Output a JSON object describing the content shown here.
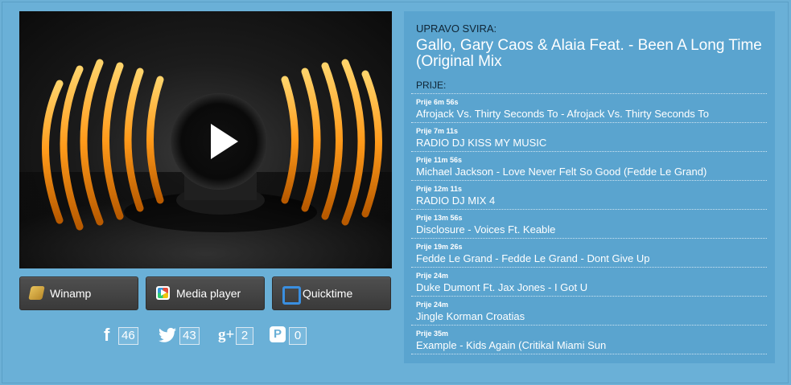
{
  "player": {
    "play_label": "Play"
  },
  "buttons": [
    {
      "label": "Winamp",
      "icon": "winamp-icon"
    },
    {
      "label": "Media player",
      "icon": "media-player-icon"
    },
    {
      "label": "Quicktime",
      "icon": "quicktime-icon"
    }
  ],
  "social": [
    {
      "network": "facebook",
      "glyph": "f",
      "count": "46",
      "icon": "facebook-icon"
    },
    {
      "network": "twitter",
      "glyph": "🐦",
      "count": "43",
      "icon": "twitter-icon"
    },
    {
      "network": "google-plus",
      "glyph": "g+",
      "count": "2",
      "icon": "google-plus-icon"
    },
    {
      "network": "pinterest",
      "glyph": "P",
      "count": "0",
      "icon": "pinterest-icon"
    }
  ],
  "now_playing": {
    "label": "UPRAVO SVIRA:",
    "title": "Gallo, Gary Caos & Alaia Feat. - Been A Long Time (Original Mix"
  },
  "history": {
    "label": "PRIJE:",
    "items": [
      {
        "time": "Prije 6m 56s",
        "title": "Afrojack Vs. Thirty Seconds To - Afrojack Vs. Thirty Seconds To"
      },
      {
        "time": "Prije 7m 11s",
        "title": "RADIO DJ KISS MY MUSIC"
      },
      {
        "time": "Prije 11m 56s",
        "title": "Michael Jackson - Love Never Felt So Good (Fedde Le Grand)"
      },
      {
        "time": "Prije 12m 11s",
        "title": "RADIO DJ MIX 4"
      },
      {
        "time": "Prije 13m 56s",
        "title": "Disclosure - Voices Ft. Keable"
      },
      {
        "time": "Prije 19m 26s",
        "title": "Fedde Le Grand - Fedde Le Grand - Dont Give Up"
      },
      {
        "time": "Prije 24m",
        "title": "Duke Dumont Ft. Jax Jones - I Got U"
      },
      {
        "time": "Prije 24m",
        "title": "Jingle Korman Croatias"
      },
      {
        "time": "Prije 35m",
        "title": "Example - Kids Again (Critikal Miami Sun"
      }
    ]
  },
  "colors": {
    "background": "#6ab0d7",
    "panel": "#5aa4cf",
    "button": "#444444",
    "accent_orange": "#ff9a1a"
  }
}
